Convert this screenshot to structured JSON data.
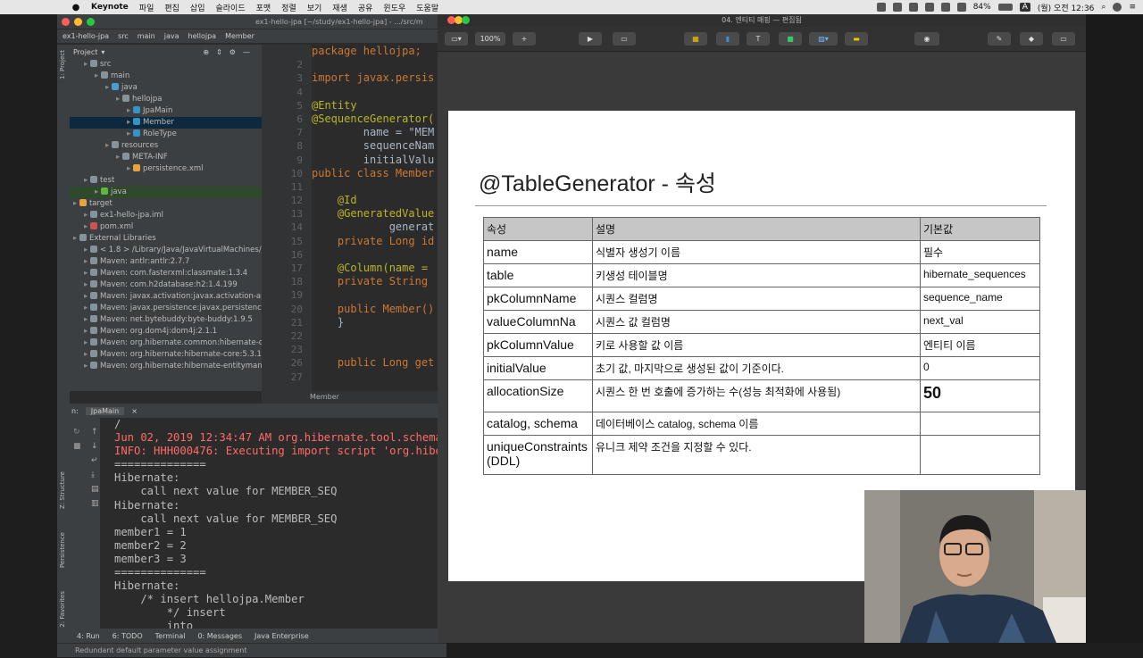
{
  "menubar": {
    "app": "Keynote",
    "items": [
      "파일",
      "편집",
      "삽입",
      "슬라이드",
      "포맷",
      "정렬",
      "보기",
      "재생",
      "공유",
      "윈도우",
      "도움말"
    ],
    "battery": "84%",
    "input_source": "A",
    "clock": "(월) 오전 12:36"
  },
  "ide": {
    "window_title": "ex1-hello-jpa [~/study/ex1-hello-jpa] - .../src/m",
    "breadcrumb": [
      "ex1-hello-jpa",
      "src",
      "main",
      "java",
      "hellojpa",
      "Member"
    ],
    "project_label": "Project",
    "left_tabs": [
      "1: Project",
      "Z: Structure",
      "Persistence",
      "2: Favorites"
    ],
    "tree": [
      {
        "label": "src",
        "indent": 1,
        "icon": "folder-icon",
        "color": "#87939a"
      },
      {
        "label": "main",
        "indent": 2,
        "icon": "folder-icon",
        "color": "#87939a"
      },
      {
        "label": "java",
        "indent": 3,
        "icon": "folder-icon",
        "color": "#4c9bd1"
      },
      {
        "label": "hellojpa",
        "indent": 4,
        "icon": "package-icon",
        "color": "#87939a"
      },
      {
        "label": "JpaMain",
        "indent": 5,
        "icon": "class-icon",
        "color": "#3592c4"
      },
      {
        "label": "Member",
        "indent": 5,
        "icon": "class-icon",
        "color": "#3592c4",
        "selected": true
      },
      {
        "label": "RoleType",
        "indent": 5,
        "icon": "enum-icon",
        "color": "#3592c4"
      },
      {
        "label": "resources",
        "indent": 3,
        "icon": "folder-icon",
        "color": "#87939a"
      },
      {
        "label": "META-INF",
        "indent": 4,
        "icon": "folder-icon",
        "color": "#87939a"
      },
      {
        "label": "persistence.xml",
        "indent": 5,
        "icon": "xml-icon",
        "color": "#e8a33d"
      },
      {
        "label": "test",
        "indent": 1,
        "icon": "folder-icon",
        "color": "#87939a"
      },
      {
        "label": "java",
        "indent": 2,
        "icon": "folder-icon",
        "color": "#62b543",
        "green": true
      },
      {
        "label": "target",
        "indent": 0,
        "icon": "folder-icon",
        "color": "#e8a33d"
      },
      {
        "label": "ex1-hello-jpa.iml",
        "indent": 1,
        "icon": "iml-icon",
        "color": "#87939a"
      },
      {
        "label": "pom.xml",
        "indent": 1,
        "icon": "maven-icon",
        "color": "#c75450"
      },
      {
        "label": "External Libraries",
        "indent": 0,
        "icon": "library-icon",
        "color": "#87939a"
      },
      {
        "label": "< 1.8 > /Library/Java/JavaVirtualMachines/j",
        "indent": 1,
        "icon": "library-icon",
        "color": "#87939a"
      },
      {
        "label": "Maven: antlr:antlr:2.7.7",
        "indent": 1,
        "icon": "library-icon",
        "color": "#87939a"
      },
      {
        "label": "Maven: com.fasterxml:classmate:1.3.4",
        "indent": 1,
        "icon": "library-icon",
        "color": "#87939a"
      },
      {
        "label": "Maven: com.h2database:h2:1.4.199",
        "indent": 1,
        "icon": "library-icon",
        "color": "#87939a"
      },
      {
        "label": "Maven: javax.activation:javax.activation-ap",
        "indent": 1,
        "icon": "library-icon",
        "color": "#87939a"
      },
      {
        "label": "Maven: javax.persistence:javax.persistence",
        "indent": 1,
        "icon": "library-icon",
        "color": "#87939a"
      },
      {
        "label": "Maven: net.bytebuddy:byte-buddy:1.9.5",
        "indent": 1,
        "icon": "library-icon",
        "color": "#87939a"
      },
      {
        "label": "Maven: org.dom4j:dom4j:2.1.1",
        "indent": 1,
        "icon": "library-icon",
        "color": "#87939a"
      },
      {
        "label": "Maven: org.hibernate.common:hibernate-c",
        "indent": 1,
        "icon": "library-icon",
        "color": "#87939a"
      },
      {
        "label": "Maven: org.hibernate:hibernate-core:5.3.1",
        "indent": 1,
        "icon": "library-icon",
        "color": "#87939a"
      },
      {
        "label": "Maven: org.hibernate:hibernate-entitymana",
        "indent": 1,
        "icon": "library-icon",
        "color": "#87939a"
      }
    ],
    "line_numbers": [
      "",
      "2",
      "3",
      "4",
      "5",
      "6",
      "7",
      "8",
      "9",
      "10",
      "11",
      "12",
      "13",
      "14",
      "15",
      "16",
      "17",
      "18",
      "19",
      "20",
      "21",
      "22",
      "23",
      "26",
      "27"
    ],
    "code": [
      "package hellojpa;",
      "",
      "import javax.persis",
      "",
      "@Entity",
      "@SequenceGenerator(",
      "        name = \"MEM",
      "        sequenceNam",
      "        initialValu",
      "public class Member",
      "",
      "    @Id",
      "    @GeneratedValue",
      "            generat",
      "    private Long id",
      "",
      "    @Column(name =",
      "    private String",
      "",
      "    public Member()",
      "    }",
      "",
      "",
      "    public Long get",
      ""
    ],
    "editor_footer": "Member",
    "run_tab_prefix": "n:",
    "run_tab": "JpaMain",
    "console": [
      "/",
      "Jun 02, 2019 12:34:47 AM org.hibernate.tool.schema",
      "INFO: HHH000476: Executing import script 'org.hibe",
      "==============",
      "Hibernate:",
      "    call next value for MEMBER_SEQ",
      "Hibernate:",
      "    call next value for MEMBER_SEQ",
      "member1 = 1",
      "member2 = 2",
      "member3 = 3",
      "==============",
      "Hibernate:",
      "    /* insert hellojpa.Member",
      "        */ insert",
      "        into"
    ],
    "bottom_tabs": [
      "4: Run",
      "6: TODO",
      "Terminal",
      "0: Messages",
      "Java Enterprise"
    ],
    "status": "Redundant default parameter value assignment"
  },
  "keynote": {
    "window_title": "04. 엔티티 매핑 — 편집됨",
    "zoom": "100%",
    "slide_title": "@TableGenerator - 속성",
    "table_headers": [
      "속성",
      "설명",
      "기본값"
    ],
    "table_rows": [
      [
        "name",
        "식별자 생성기 이름",
        "필수"
      ],
      [
        "table",
        "키생성 테이블명",
        "hibernate_sequences"
      ],
      [
        "pkColumnName",
        "시퀀스 컬럼명",
        "sequence_name"
      ],
      [
        "valueColumnNa",
        "시퀀스 값 컬럼명",
        "next_val"
      ],
      [
        "pkColumnValue",
        "키로 사용할 값 이름",
        "엔티티 이름"
      ],
      [
        "initialValue",
        "초기 값, 마지막으로 생성된 값이 기준이다.",
        "0"
      ],
      [
        "allocationSize",
        "시퀀스 한 번 호출에 증가하는 수(성능 최적화에 사용됨)",
        "50"
      ],
      [
        "catalog, schema",
        "데이터베이스 catalog, schema 이름",
        ""
      ],
      [
        "uniqueConstraints(DDL)",
        "유니크 제약 조건을 지정할 수 있다.",
        ""
      ]
    ]
  }
}
